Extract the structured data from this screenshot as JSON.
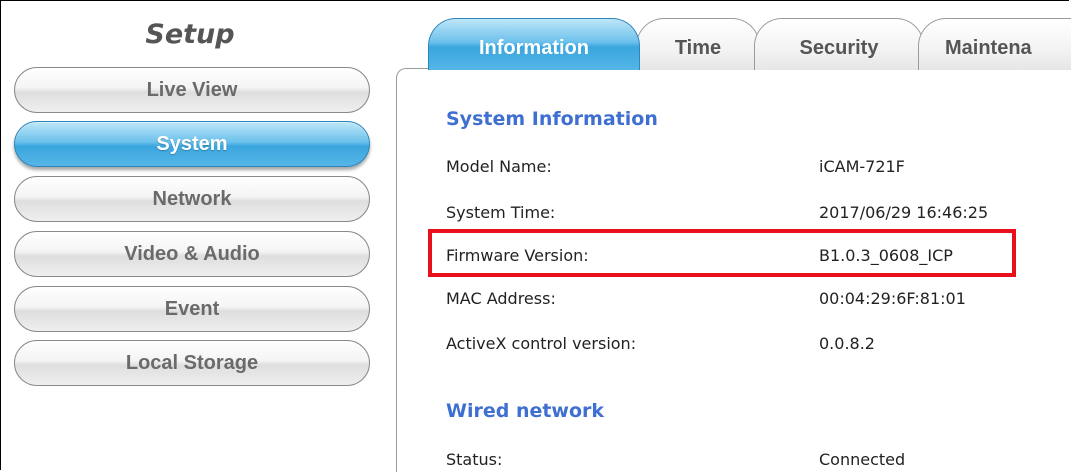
{
  "sidebar": {
    "title": "Setup",
    "items": [
      {
        "label": "Live View",
        "active": false
      },
      {
        "label": "System",
        "active": true
      },
      {
        "label": "Network",
        "active": false
      },
      {
        "label": "Video & Audio",
        "active": false
      },
      {
        "label": "Event",
        "active": false
      },
      {
        "label": "Local Storage",
        "active": false
      }
    ]
  },
  "tabs": [
    {
      "label": "Information",
      "active": true
    },
    {
      "label": "Time",
      "active": false
    },
    {
      "label": "Security",
      "active": false
    },
    {
      "label": "Maintena",
      "active": false
    }
  ],
  "system_information": {
    "title": "System Information",
    "rows": [
      {
        "label": "Model Name:",
        "value": "iCAM-721F"
      },
      {
        "label": "System Time:",
        "value": "2017/06/29 16:46:25"
      },
      {
        "label": "Firmware Version:",
        "value": "B1.0.3_0608_ICP"
      },
      {
        "label": "MAC Address:",
        "value": "00:04:29:6F:81:01"
      },
      {
        "label": "ActiveX control version:",
        "value": "0.0.8.2"
      }
    ]
  },
  "wired_network": {
    "title": "Wired network",
    "rows": [
      {
        "label": "Status:",
        "value": "Connected"
      }
    ]
  },
  "colors": {
    "accent_blue": "#3aa6de",
    "section_title": "#3f6fd1",
    "highlight_box": "#e8101a"
  }
}
